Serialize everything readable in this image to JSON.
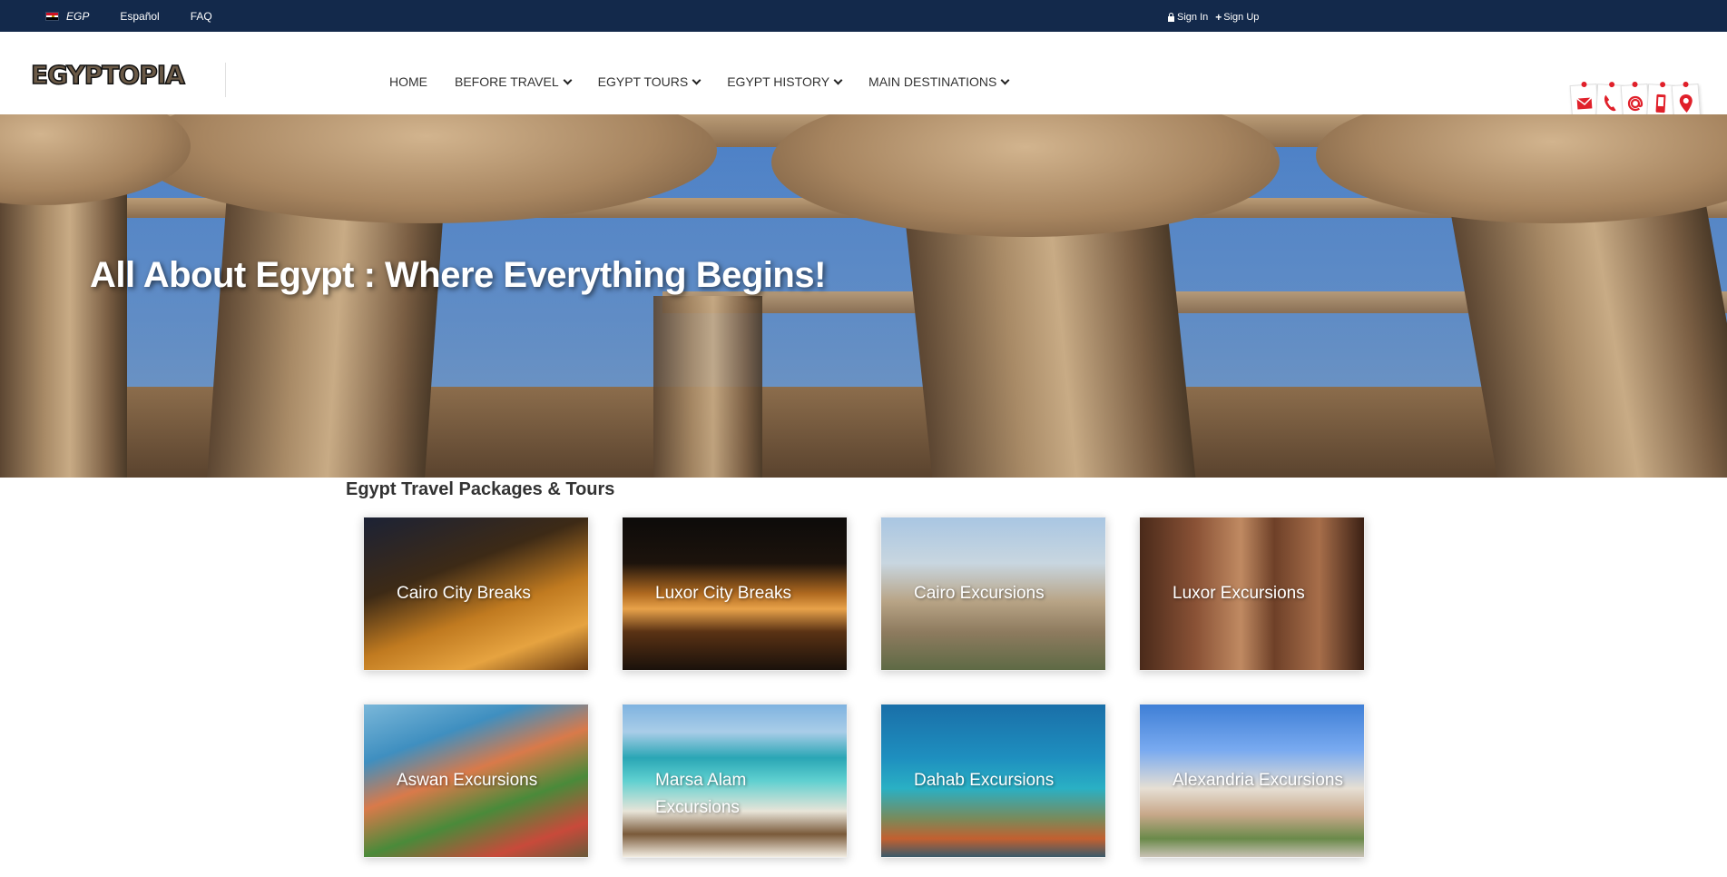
{
  "topbar": {
    "currency": "EGP",
    "language": "Español",
    "faq": "FAQ",
    "sign_in": "Sign In",
    "sign_up": "Sign Up"
  },
  "header": {
    "logo": "EGYPTOPIA",
    "nav": [
      {
        "label": "HOME",
        "dropdown": false
      },
      {
        "label": "BEFORE TRAVEL",
        "dropdown": true
      },
      {
        "label": "EGYPT TOURS",
        "dropdown": true
      },
      {
        "label": "EGYPT HISTORY",
        "dropdown": true
      },
      {
        "label": "MAIN DESTINATIONS",
        "dropdown": true
      }
    ],
    "contact_icons": [
      "mail-icon",
      "phone-icon",
      "at-icon",
      "mobile-icon",
      "location-pin-icon"
    ]
  },
  "hero": {
    "title": "All About Egypt : Where Everything Begins!"
  },
  "section": {
    "title": "Egypt Travel Packages & Tours"
  },
  "cards": [
    {
      "label": "Cairo City Breaks"
    },
    {
      "label": "Luxor City Breaks"
    },
    {
      "label": "Cairo Excursions"
    },
    {
      "label": "Luxor Excursions"
    },
    {
      "label": "Aswan Excursions"
    },
    {
      "label": "Marsa Alam Excursions"
    },
    {
      "label": "Dahab Excursions"
    },
    {
      "label": "Alexandria Excursions"
    }
  ],
  "colors": {
    "topbar": "#13294b",
    "accent_red": "#e0202a",
    "nav_text": "#333333"
  }
}
